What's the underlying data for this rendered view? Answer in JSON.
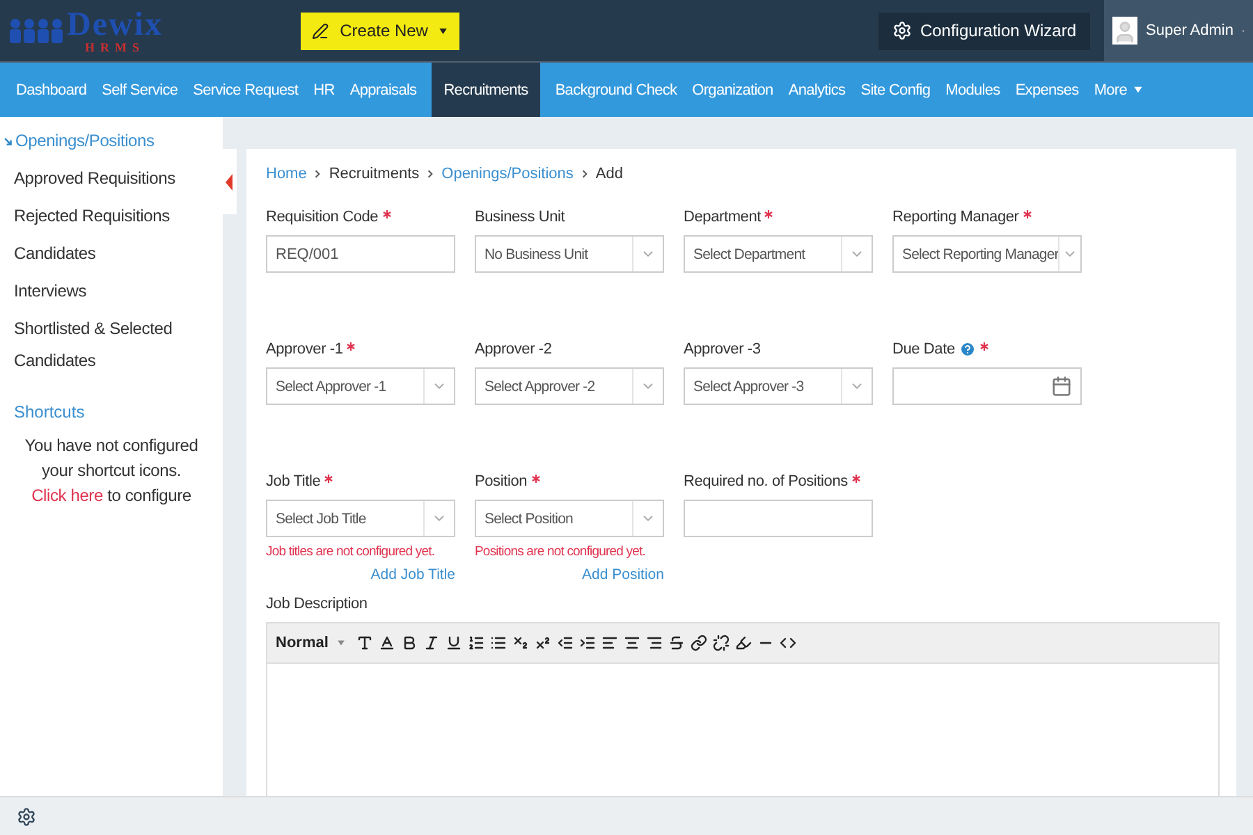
{
  "header": {
    "logo": {
      "name": "Dewix",
      "tagline": "HRMS"
    },
    "create_button": {
      "label": "Create New"
    },
    "config_button": {
      "label": "Configuration Wizard"
    },
    "user": {
      "name": "Super Admin"
    }
  },
  "nav": [
    {
      "label": "Dashboard",
      "selected": false
    },
    {
      "label": "Self Service",
      "selected": false
    },
    {
      "label": "Service Request",
      "selected": false
    },
    {
      "label": "HR",
      "selected": false
    },
    {
      "label": "Appraisals",
      "selected": false
    },
    {
      "label": "Recruitments",
      "selected": true
    },
    {
      "label": "Background Check",
      "selected": false
    },
    {
      "label": "Organization",
      "selected": false
    },
    {
      "label": "Analytics",
      "selected": false
    },
    {
      "label": "Site Config",
      "selected": false
    },
    {
      "label": "Modules",
      "selected": false
    },
    {
      "label": "Expenses",
      "selected": false
    },
    {
      "label": "More",
      "selected": false,
      "dropdown": true
    }
  ],
  "sidebar": {
    "items": [
      {
        "label": "Openings/Positions",
        "selected": true
      },
      {
        "label": "Approved Requisitions",
        "selected": false
      },
      {
        "label": "Rejected Requisitions",
        "selected": false
      },
      {
        "label": "Candidates",
        "selected": false
      },
      {
        "label": "Interviews",
        "selected": false
      },
      {
        "label": "Shortlisted & Selected Candidates",
        "selected": false
      }
    ],
    "shortcuts": {
      "title": "Shortcuts",
      "before": "You have not configured your shortcut icons.",
      "link": "Click here",
      "after": "to configure"
    }
  },
  "breadcrumb": [
    {
      "label": "Home",
      "link": true
    },
    {
      "label": "Recruitments",
      "link": false
    },
    {
      "label": "Openings/Positions",
      "link": true
    },
    {
      "label": "Add",
      "link": false
    }
  ],
  "form_rows": [
    [
      {
        "label": "Requisition Code",
        "required": true,
        "kind": "text",
        "value": "REQ/001"
      },
      {
        "label": "Business Unit",
        "required": false,
        "kind": "select",
        "placeholder": "No Business Unit"
      },
      {
        "label": "Department",
        "required": true,
        "kind": "select",
        "placeholder": "Select Department"
      },
      {
        "label": "Reporting Manager",
        "required": true,
        "kind": "select",
        "placeholder": "Select Reporting Manager"
      }
    ],
    [
      {
        "label": "Approver -1",
        "required": true,
        "kind": "select",
        "placeholder": "Select Approver -1"
      },
      {
        "label": "Approver -2",
        "required": false,
        "kind": "select",
        "placeholder": "Select Approver -2"
      },
      {
        "label": "Approver -3",
        "required": false,
        "kind": "select",
        "placeholder": "Select Approver -3"
      },
      {
        "label": "Due Date",
        "required": true,
        "kind": "date",
        "help": true
      }
    ],
    [
      {
        "label": "Job Title",
        "required": true,
        "kind": "select",
        "placeholder": "Select Job Title",
        "error": "Job titles are not configured yet.",
        "link": "Add Job Title"
      },
      {
        "label": "Position",
        "required": true,
        "kind": "select",
        "placeholder": "Select Position",
        "error": "Positions are not configured yet.",
        "link": "Add Position"
      },
      {
        "label": "Required no. of Positions",
        "required": true,
        "kind": "text"
      }
    ]
  ],
  "job_description": {
    "label": "Job Description",
    "format": "Normal"
  }
}
